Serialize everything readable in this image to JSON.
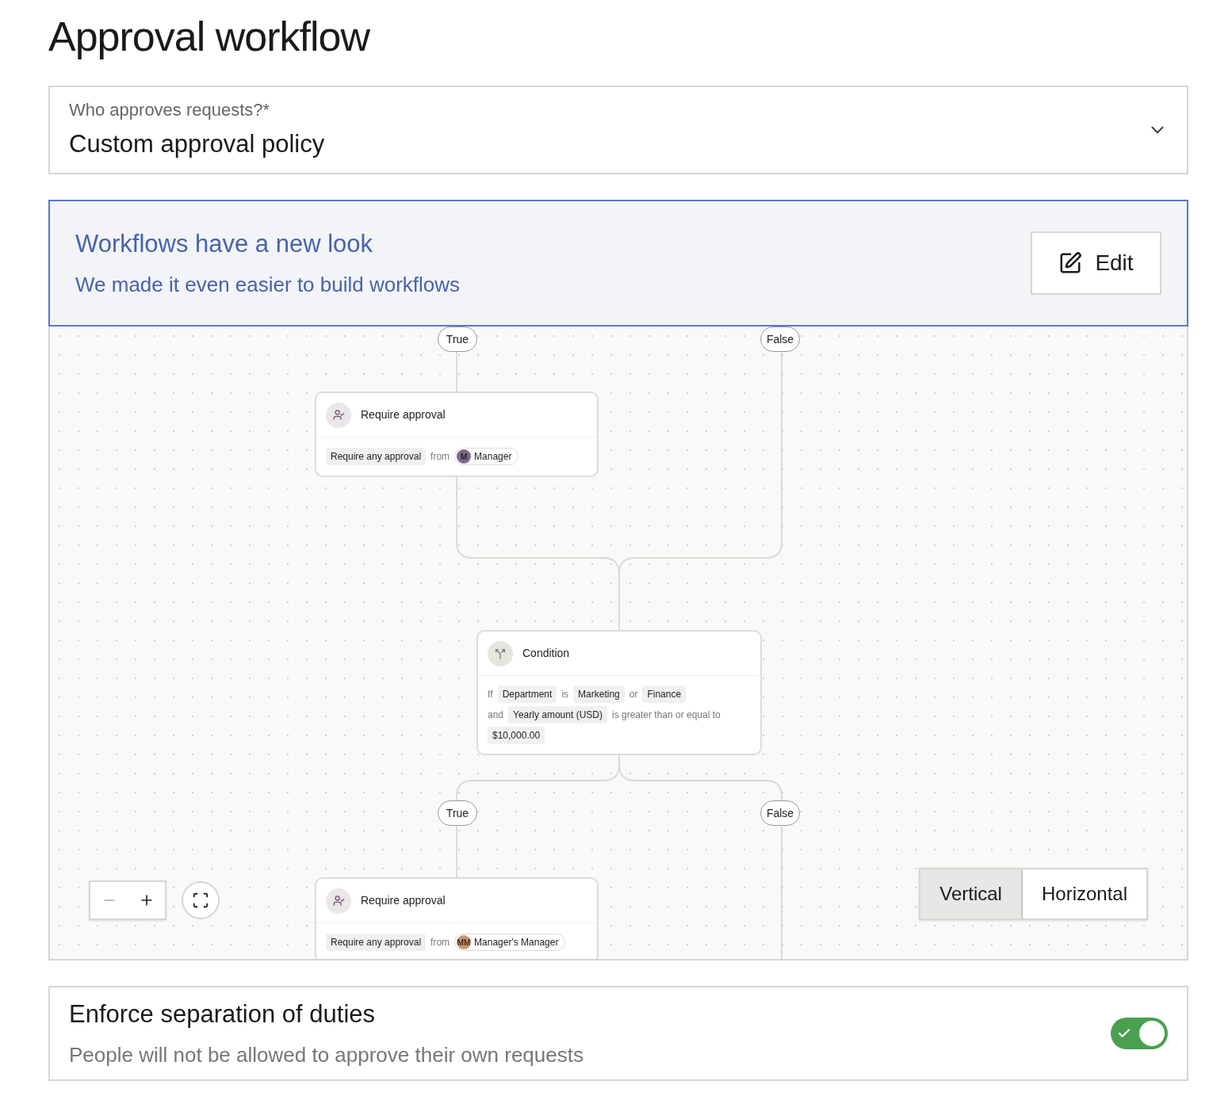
{
  "title": "Approval workflow",
  "approver_select": {
    "label": "Who approves requests?*",
    "value": "Custom approval policy"
  },
  "banner": {
    "title": "Workflows have a new look",
    "subtitle": "We made it even easier to build workflows",
    "edit_button": "Edit"
  },
  "canvas": {
    "branch_labels": [
      "True",
      "False",
      "True",
      "False"
    ],
    "nodes": [
      {
        "kind": "approval",
        "title": "Require approval",
        "mode": "Require any approval",
        "from": "from",
        "assignee": {
          "initials": "M",
          "name": "Manager",
          "color": "#7a6a8a"
        }
      },
      {
        "kind": "condition",
        "title": "Condition",
        "lines": [
          [
            {
              "kind": "word",
              "text": "If"
            },
            {
              "kind": "chip",
              "text": "Department"
            },
            {
              "kind": "word",
              "text": "is"
            },
            {
              "kind": "chip",
              "text": "Marketing"
            },
            {
              "kind": "word",
              "text": "or"
            },
            {
              "kind": "chip",
              "text": "Finance"
            }
          ],
          [
            {
              "kind": "word",
              "text": "and"
            },
            {
              "kind": "chip",
              "text": "Yearly amount (USD)"
            },
            {
              "kind": "word",
              "text": "is greater than or equal to"
            }
          ],
          [
            {
              "kind": "chip",
              "text": "$10,000.00"
            }
          ]
        ]
      },
      {
        "kind": "approval",
        "title": "Require approval",
        "mode": "Require any approval",
        "from": "from",
        "assignee": {
          "initials": "MM",
          "name": "Manager's Manager",
          "color": "#c8956c"
        }
      }
    ],
    "layout_options": [
      {
        "label": "Vertical",
        "selected": true
      },
      {
        "label": "Horizontal",
        "selected": false
      }
    ]
  },
  "separation": {
    "title": "Enforce separation of duties",
    "description": "People will not be allowed to approve their own requests",
    "on": true
  }
}
